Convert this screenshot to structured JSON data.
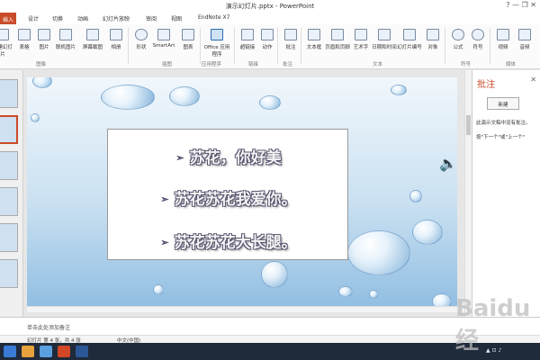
{
  "window": {
    "title": "演示幻灯片.pptx - PowerPoint",
    "controls": "?  —  ❐  ✕"
  },
  "menu": {
    "tabs": [
      "插入",
      "设计",
      "切换",
      "动画",
      "幻灯片放映",
      "审阅",
      "视图",
      "EndNote X7"
    ],
    "active": "插入"
  },
  "ribbon": {
    "buttons": [
      "新建幻灯片",
      "表格",
      "图片",
      "联机图片",
      "屏幕截图",
      "相册",
      "形状",
      "SmartArt",
      "图表",
      "Office 应用程序",
      "超链接",
      "动作",
      "批注",
      "文本框",
      "页眉和页脚",
      "艺术字",
      "日期和时间",
      "幻灯片编号",
      "对象",
      "公式",
      "符号",
      "视频",
      "音频"
    ],
    "groups": [
      "图像",
      "插图",
      "应用程序",
      "链接",
      "批注",
      "文本",
      "符号",
      "媒体"
    ]
  },
  "slide": {
    "lines": [
      "苏花，你好美",
      "苏花苏花我爱你。",
      "苏花苏花大长腿。"
    ],
    "bullet": "➢"
  },
  "comments": {
    "title": "批注",
    "close": "✕",
    "new_button": "新建",
    "text1": "此演示文稿中没有批注。",
    "text2": "按\"下一个\"或\"上一个\""
  },
  "notes": {
    "placeholder": "单击此处添加备注"
  },
  "status": {
    "slide": "幻灯片 第 4 张，共 4 张",
    "language": "中文(中国)"
  },
  "watermark": "Baidu 经"
}
